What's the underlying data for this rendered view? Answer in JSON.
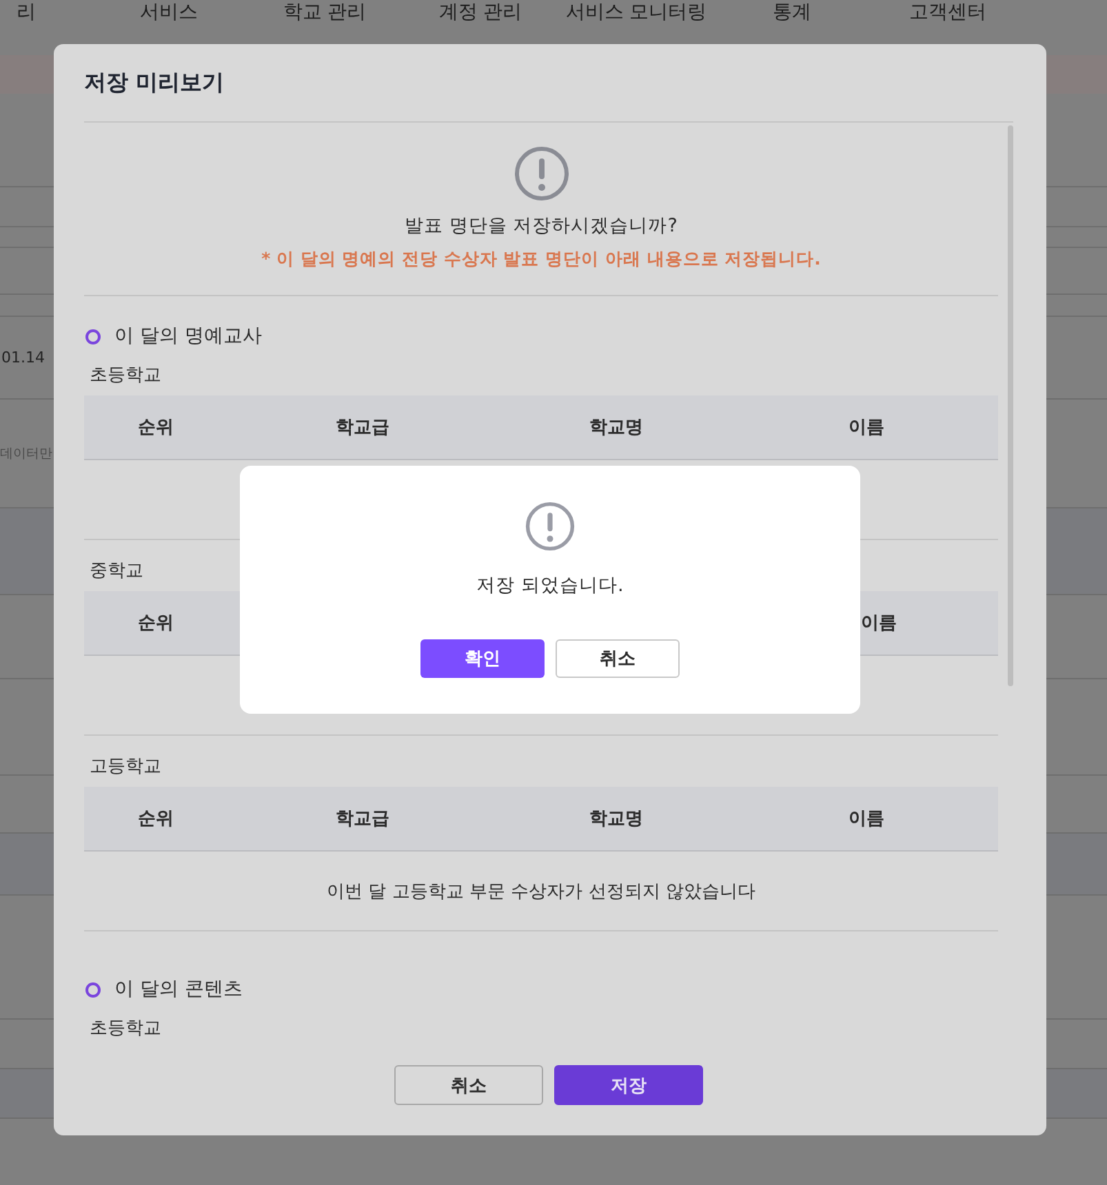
{
  "background": {
    "nav_items": [
      "리",
      "서비스",
      "학교 관리",
      "계정 관리",
      "서비스 모니터링",
      "통계",
      "고객센터"
    ],
    "rows": [
      {
        "text": "01.14"
      },
      {
        "text": "데이터만"
      }
    ]
  },
  "preview_dialog": {
    "title": "저장 미리보기",
    "notice": {
      "question": "발표 명단을 저장하시겠습니까?",
      "note": "* 이 달의 명예의 전당 수상자 발표 명단이 아래 내용으로 저장됩니다."
    },
    "sections": [
      {
        "title": "이 달의 명예교사",
        "groups": [
          {
            "label": "초등학교",
            "columns": [
              "순위",
              "학교급",
              "학교명",
              "이름"
            ]
          },
          {
            "label": "중학교",
            "columns": [
              "순위",
              "이름"
            ]
          },
          {
            "label": "고등학교",
            "columns": [
              "순위",
              "학교급",
              "학교명",
              "이름"
            ],
            "message": "이번 달 고등학교 부문 수상자가 선정되지 않았습니다"
          }
        ]
      },
      {
        "title": "이 달의 콘텐츠",
        "groups": [
          {
            "label": "초등학교"
          }
        ]
      }
    ],
    "buttons": [
      {
        "label": "취소",
        "kind": "secondary"
      },
      {
        "label": "저장",
        "kind": "primary"
      }
    ]
  },
  "alert": {
    "message": "저장 되었습니다.",
    "buttons": [
      {
        "label": "확인",
        "kind": "primary"
      },
      {
        "label": "취소",
        "kind": "secondary"
      }
    ]
  }
}
